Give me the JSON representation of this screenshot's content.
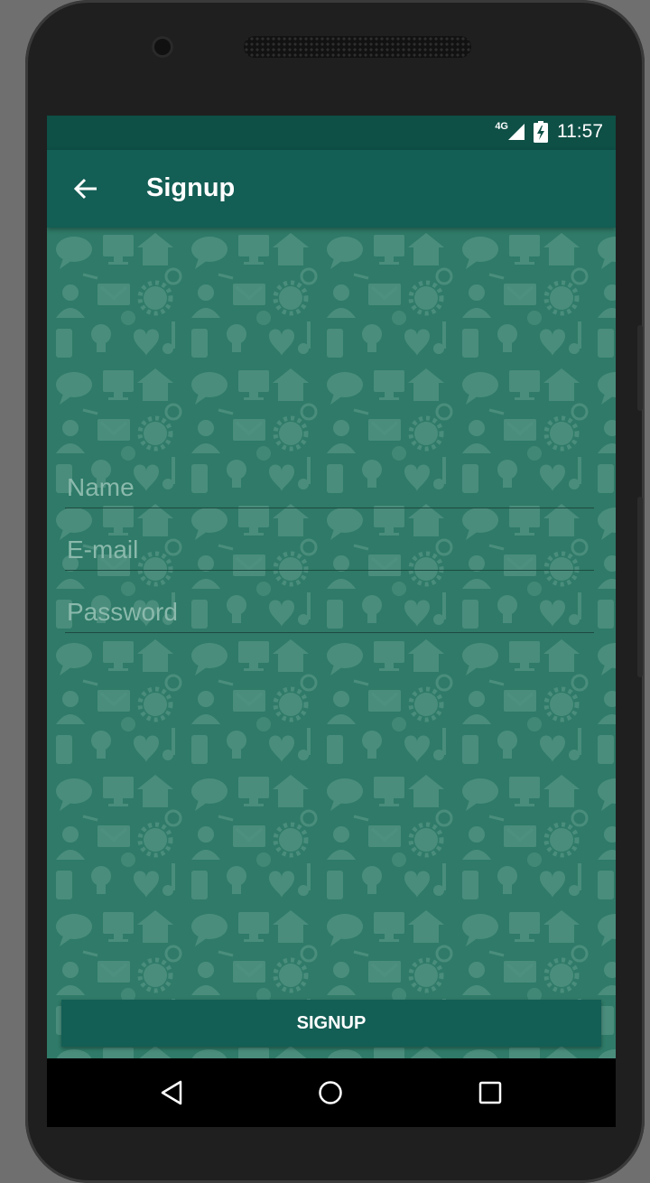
{
  "status_bar": {
    "network": "4G",
    "time": "11:57"
  },
  "app_bar": {
    "title": "Signup",
    "back_icon": "arrow-back-icon"
  },
  "form": {
    "name_placeholder": "Name",
    "email_placeholder": "E-mail",
    "password_placeholder": "Password"
  },
  "signup_button": {
    "label": "SIGNUP"
  },
  "nav_bar": {
    "back": "triangle-back-icon",
    "home": "circle-home-icon",
    "recents": "square-recents-icon"
  },
  "colors": {
    "primary": "#135e55",
    "primary_dark": "#0e4f46",
    "background": "#2f7a68",
    "hint": "#8ab9ab"
  }
}
